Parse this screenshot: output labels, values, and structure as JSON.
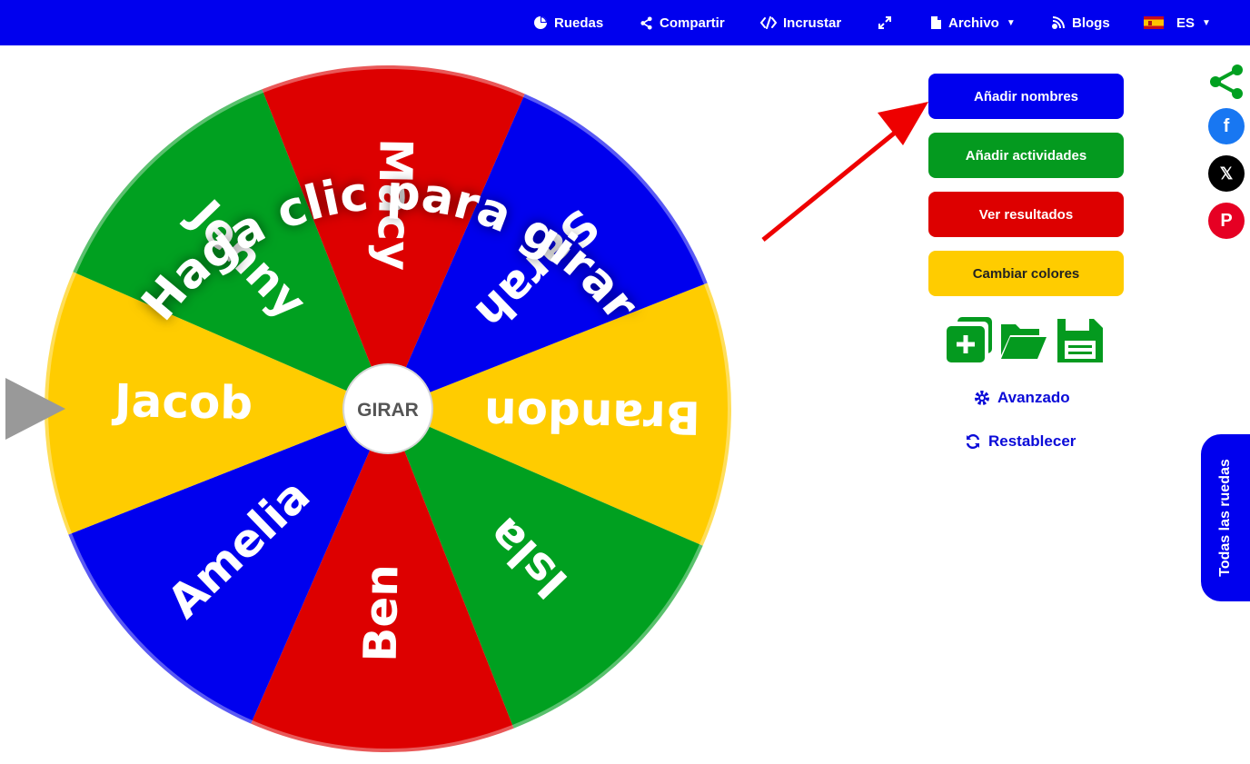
{
  "nav": {
    "wheels": "Ruedas",
    "share": "Compartir",
    "embed": "Incrustar",
    "file": "Archivo",
    "blogs": "Blogs",
    "language": "ES"
  },
  "sidebar": {
    "add_names": "Añadir nombres",
    "add_activities": "Añadir actividades",
    "view_results": "Ver resultados",
    "change_colors": "Cambiar colores",
    "advanced": "Avanzado",
    "reset": "Restablecer"
  },
  "wheel": {
    "center_label": "GIRAR",
    "prompt": "Haga clic para girar",
    "segments": [
      {
        "name": "Brandon",
        "color": "#ffcc00"
      },
      {
        "name": "Isla",
        "color": "#00a020"
      },
      {
        "name": "Ben",
        "color": "#dd0000"
      },
      {
        "name": "Amelia",
        "color": "#0000ee"
      },
      {
        "name": "Jacob",
        "color": "#ffcc00"
      },
      {
        "name": "Jenny",
        "color": "#00a020"
      },
      {
        "name": "Macy",
        "color": "#dd0000"
      },
      {
        "name": "Sarah",
        "color": "#0000ee"
      }
    ]
  },
  "tabs": {
    "all_wheels": "Todas las ruedas"
  },
  "colors": {
    "primary": "#0000ee",
    "green": "#00a020",
    "red": "#dd0000",
    "yellow": "#ffcc00",
    "arrow": "#ee0000"
  }
}
